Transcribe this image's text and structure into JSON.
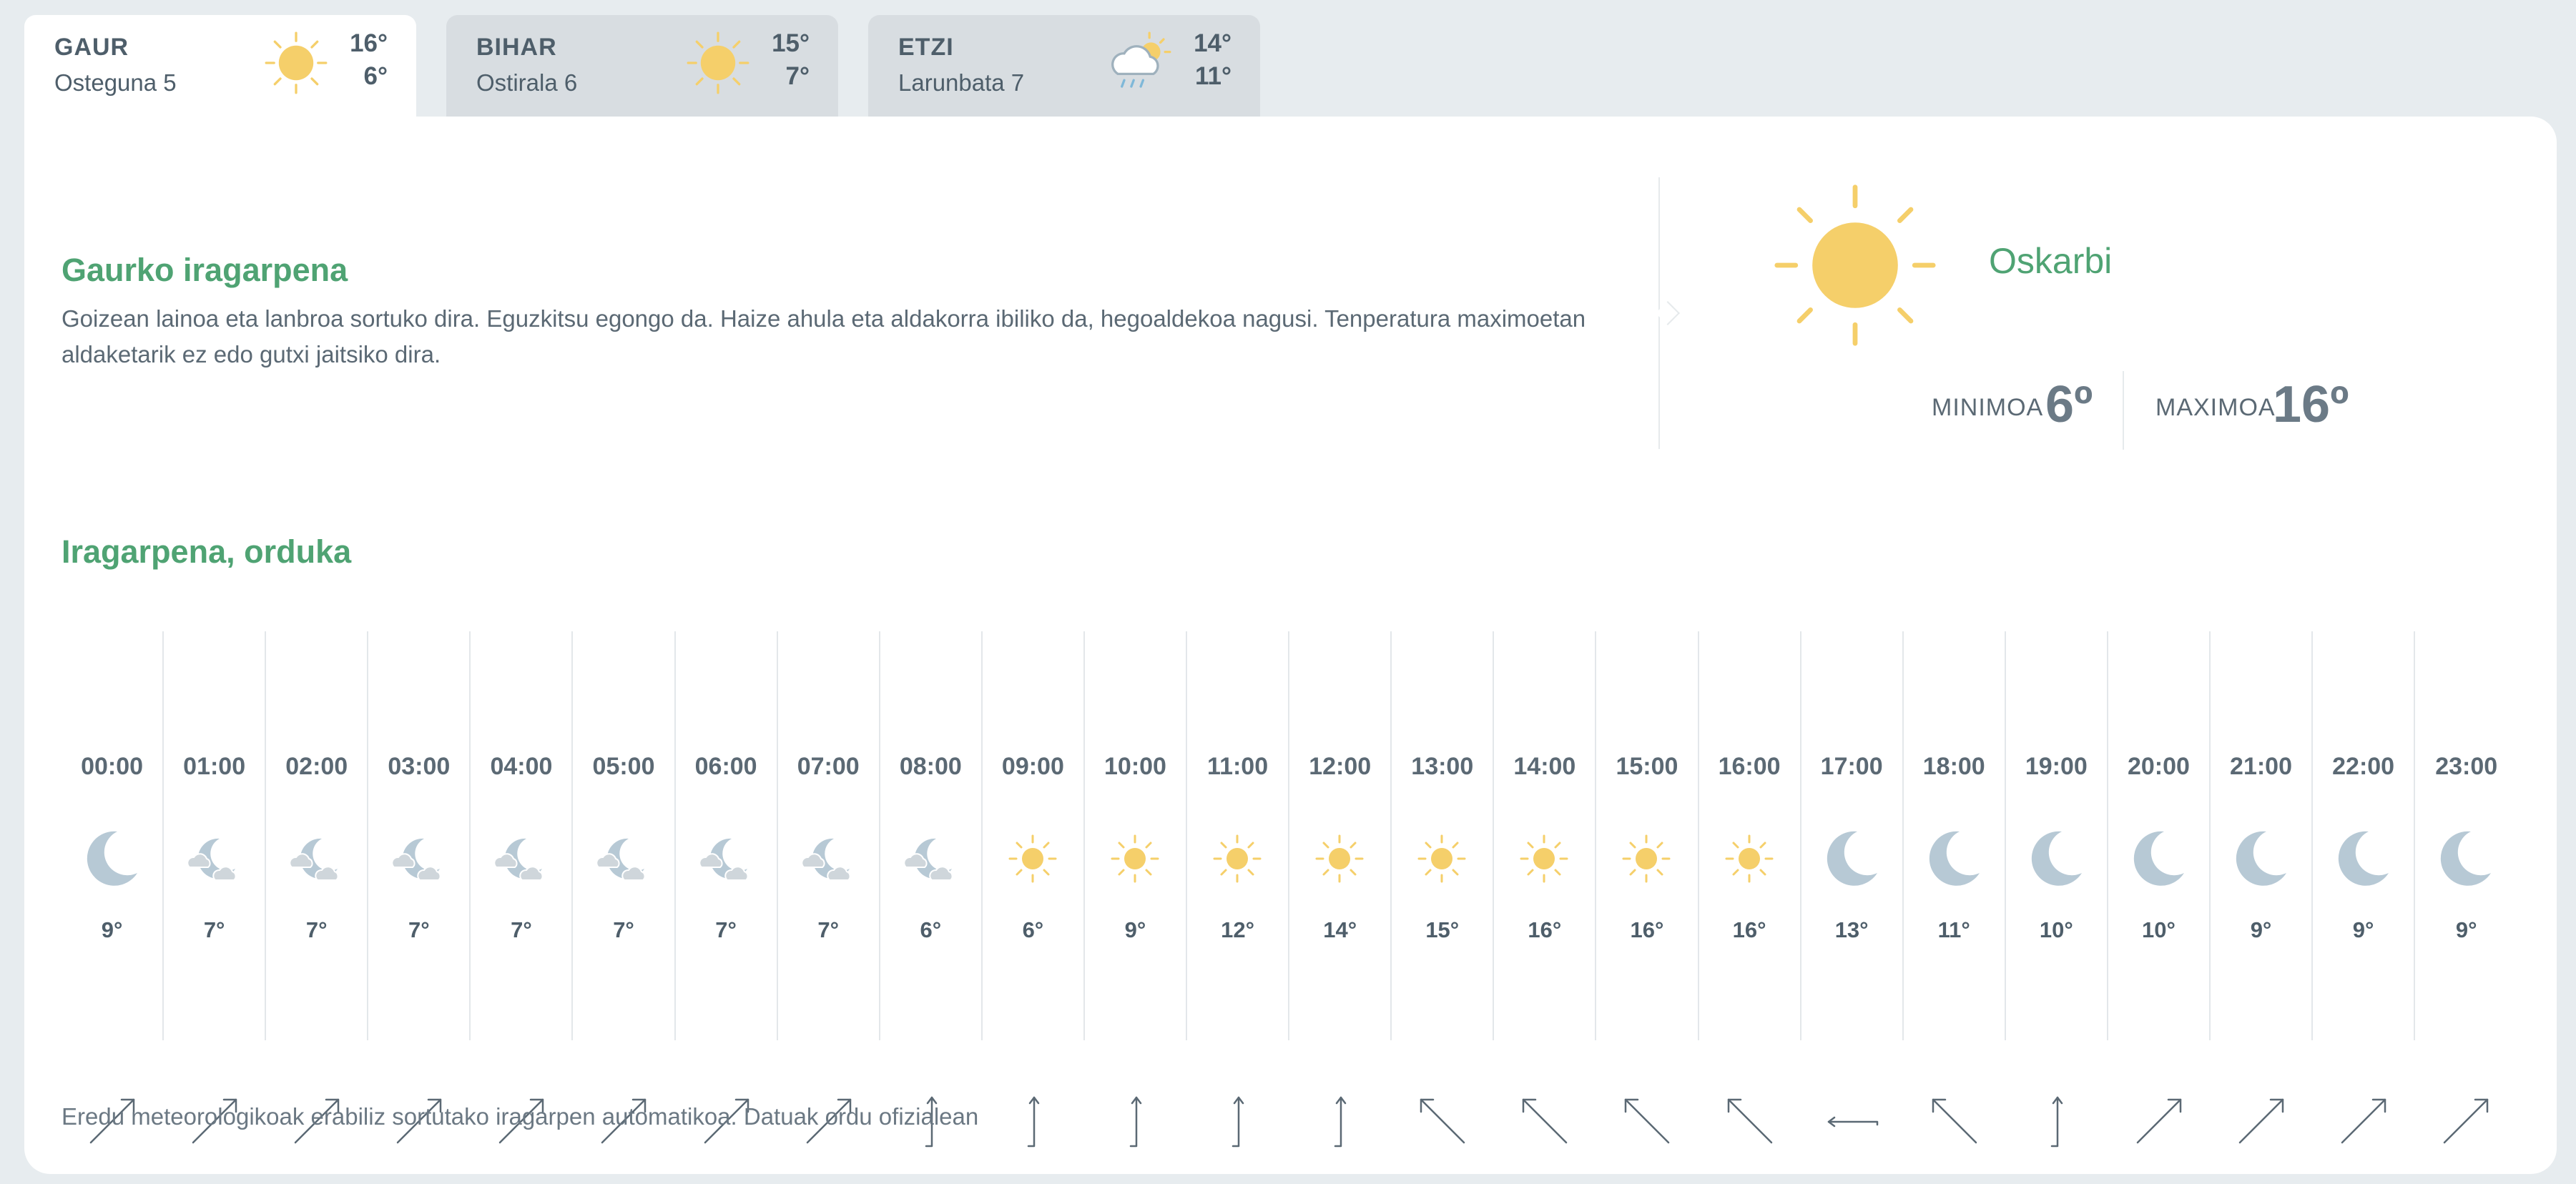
{
  "tabs": [
    {
      "name": "GAUR",
      "date": "Osteguna 5",
      "max": "16°",
      "min": "6°",
      "icon": "sun-icon",
      "active": true
    },
    {
      "name": "BIHAR",
      "date": "Ostirala 6",
      "max": "15°",
      "min": "7°",
      "icon": "sun-icon",
      "active": false
    },
    {
      "name": "ETZI",
      "date": "Larunbata 7",
      "max": "14°",
      "min": "11°",
      "icon": "rain-sun-cloud-icon",
      "active": false
    }
  ],
  "today": {
    "title": "Gaurko iragarpena",
    "text": "Goizean lainoa eta lanbroa sortuko dira. Eguzkitsu egongo da. Haize ahula eta aldakorra ibiliko da, hegoaldekoa nagusi. Tenperatura maximoetan aldaketarik ez edo gutxi jaitsiko dira.",
    "condition": "Oskarbi",
    "condition_icon": "sun-icon",
    "min_label": "MINIMOA",
    "min_value": "6º",
    "max_label": "MAXIMOA",
    "max_value": "16º"
  },
  "hourly": {
    "title": "Iragarpena, orduka",
    "hours": [
      {
        "time": "00:00",
        "icon": "moon-icon",
        "temp": "9°",
        "wind_dir": "ne"
      },
      {
        "time": "01:00",
        "icon": "moon-cloud-icon",
        "temp": "7°",
        "wind_dir": "ne"
      },
      {
        "time": "02:00",
        "icon": "moon-cloud-icon",
        "temp": "7°",
        "wind_dir": "ne"
      },
      {
        "time": "03:00",
        "icon": "moon-cloud-icon",
        "temp": "7°",
        "wind_dir": "ne"
      },
      {
        "time": "04:00",
        "icon": "moon-cloud-icon",
        "temp": "7°",
        "wind_dir": "ne"
      },
      {
        "time": "05:00",
        "icon": "moon-cloud-icon",
        "temp": "7°",
        "wind_dir": "ne"
      },
      {
        "time": "06:00",
        "icon": "moon-cloud-icon",
        "temp": "7°",
        "wind_dir": "ne"
      },
      {
        "time": "07:00",
        "icon": "moon-cloud-icon",
        "temp": "7°",
        "wind_dir": "ne"
      },
      {
        "time": "08:00",
        "icon": "moon-cloud-icon",
        "temp": "6°",
        "wind_dir": "n"
      },
      {
        "time": "09:00",
        "icon": "sun-icon",
        "temp": "6°",
        "wind_dir": "n"
      },
      {
        "time": "10:00",
        "icon": "sun-icon",
        "temp": "9°",
        "wind_dir": "n"
      },
      {
        "time": "11:00",
        "icon": "sun-icon",
        "temp": "12°",
        "wind_dir": "n"
      },
      {
        "time": "12:00",
        "icon": "sun-icon",
        "temp": "14°",
        "wind_dir": "n"
      },
      {
        "time": "13:00",
        "icon": "sun-icon",
        "temp": "15°",
        "wind_dir": "nw"
      },
      {
        "time": "14:00",
        "icon": "sun-icon",
        "temp": "16°",
        "wind_dir": "nw"
      },
      {
        "time": "15:00",
        "icon": "sun-icon",
        "temp": "16°",
        "wind_dir": "nw"
      },
      {
        "time": "16:00",
        "icon": "sun-icon",
        "temp": "16°",
        "wind_dir": "nw"
      },
      {
        "time": "17:00",
        "icon": "moon-icon",
        "temp": "13°",
        "wind_dir": "w"
      },
      {
        "time": "18:00",
        "icon": "moon-icon",
        "temp": "11°",
        "wind_dir": "nw"
      },
      {
        "time": "19:00",
        "icon": "moon-icon",
        "temp": "10°",
        "wind_dir": "n"
      },
      {
        "time": "20:00",
        "icon": "moon-icon",
        "temp": "10°",
        "wind_dir": "ne"
      },
      {
        "time": "21:00",
        "icon": "moon-icon",
        "temp": "9°",
        "wind_dir": "ne"
      },
      {
        "time": "22:00",
        "icon": "moon-icon",
        "temp": "9°",
        "wind_dir": "ne"
      },
      {
        "time": "23:00",
        "icon": "moon-icon",
        "temp": "9°",
        "wind_dir": "ne"
      }
    ]
  },
  "footer": "Eredu meteorologikoak erabiliz sortutako iragarpen automatikoa. Datuak ordu ofizialean",
  "colors": {
    "accent": "#4fa373",
    "sun": "#f5cf6a",
    "moon": "#b7c9d5",
    "cloud": "#cfd6db",
    "text": "#4a5a66"
  }
}
